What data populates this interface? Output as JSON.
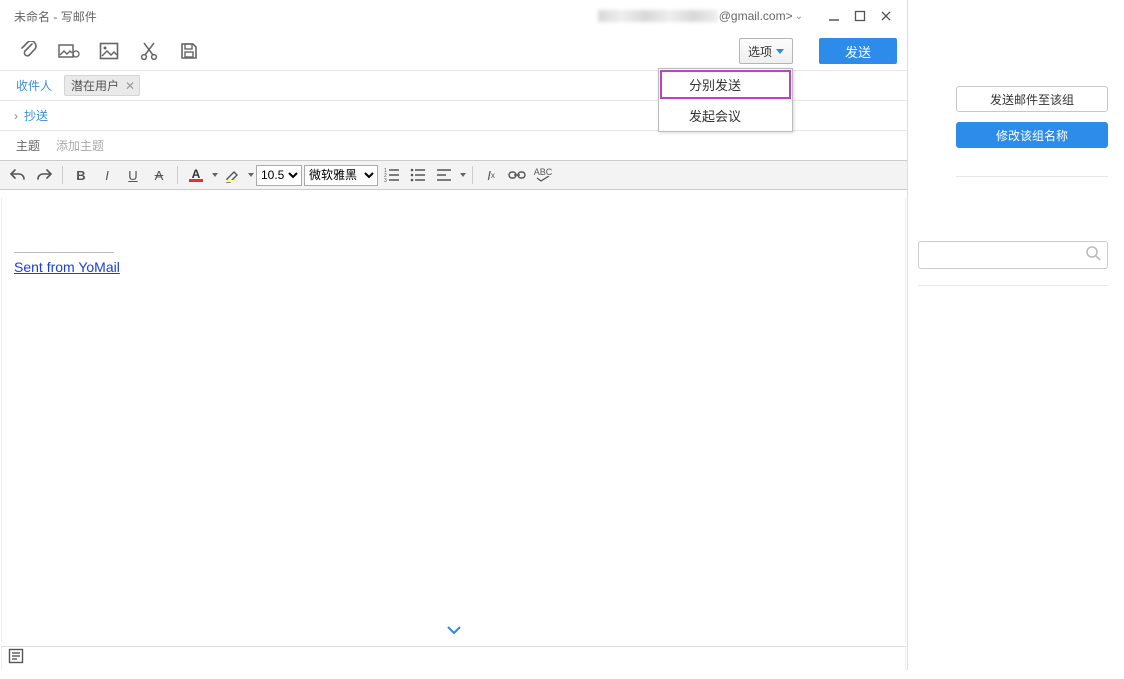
{
  "window": {
    "title_untitled": "未命名",
    "title_sep": " - ",
    "title_compose": "写邮件",
    "account_suffix": "@gmail.com>"
  },
  "toolbar": {
    "options_label": "选项",
    "send_label": "发送"
  },
  "options_menu": {
    "items": [
      {
        "label": "分别发送"
      },
      {
        "label": "发起会议"
      }
    ]
  },
  "fields": {
    "recipient_label": "收件人",
    "recipient_chip": "潜在用户",
    "cc_label": "抄送",
    "subject_label": "主题",
    "subject_placeholder": "添加主题"
  },
  "editor": {
    "font_size_value": "10.5",
    "font_family_value": "微软雅黑",
    "abc_label": "ABC"
  },
  "body": {
    "signature_link": "Sent from YoMail"
  },
  "right_panel": {
    "send_to_group_label": "发送邮件至该组",
    "rename_group_label": "修改该组名称"
  }
}
